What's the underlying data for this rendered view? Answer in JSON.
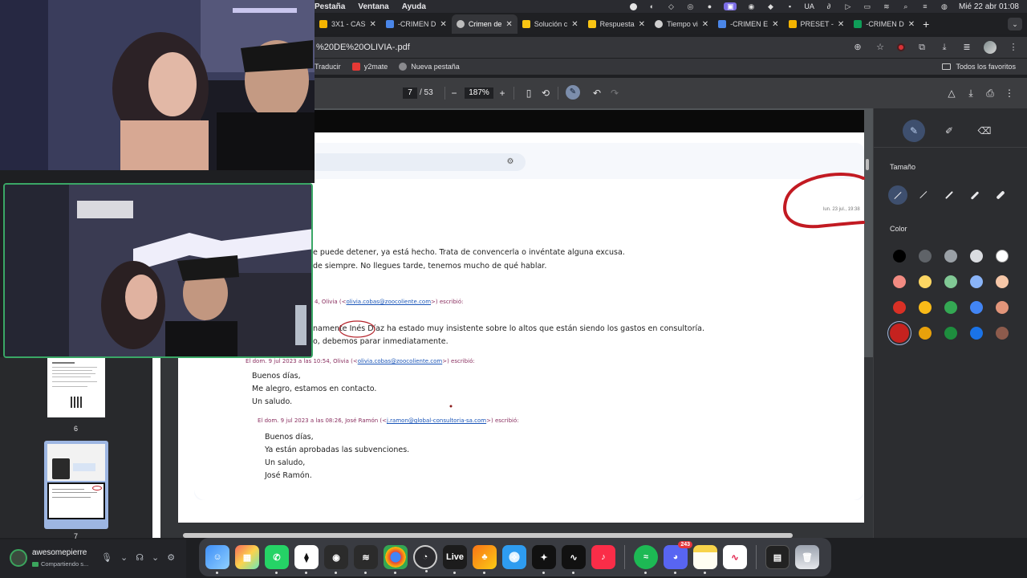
{
  "menubar": {
    "menus": [
      "Pestaña",
      "Ventana",
      "Ayuda"
    ],
    "keyboard": "UA",
    "clock": "Mié 22 abr  01:08"
  },
  "tabs": [
    {
      "title": "3X1 - CAS",
      "color": "#f4b400",
      "active": false
    },
    {
      "title": "-CRIMEN D",
      "color": "#4a86e8",
      "active": false
    },
    {
      "title": "Crimen de",
      "color": "#bdbdbd",
      "active": true
    },
    {
      "title": "Solución c",
      "color": "#f9c513",
      "active": false
    },
    {
      "title": "Respuesta",
      "color": "#f9c513",
      "active": false
    },
    {
      "title": "Tiempo vi",
      "color": "#cfcfcf",
      "active": false
    },
    {
      "title": "-CRIMEN E",
      "color": "#4a86e8",
      "active": false
    },
    {
      "title": "PRESET -",
      "color": "#f4b400",
      "active": false
    },
    {
      "title": "-CRIMEN D",
      "color": "#0f9d58",
      "active": false
    }
  ],
  "address": {
    "url": "%20DE%20OLIVIA-.pdf"
  },
  "bookmarks": {
    "items": [
      "Traducir",
      "y2mate",
      "Nueva pestaña"
    ],
    "all": "Todos los favoritos"
  },
  "pdf_toolbar": {
    "page": "7",
    "total": "/ 53",
    "zoom": "187%"
  },
  "email": {
    "date_small": "lun. 23 jul., 19:38",
    "line1": "e puede detener, ya está hecho. Trata de convencerla o invéntate alguna excusa.",
    "line2": "de siempre. No llegues tarde, tenemos mucho de qué hablar.",
    "meta1_prefix": "4, Olivia (<",
    "meta1_link": "olivia.cobas@zoocoliente.com",
    "meta1_suffix": ">) escribió:",
    "line3_pre": "namente ",
    "line3_name": "Inés Díaz",
    "line3_post": " ha estado muy insistente sobre lo altos que están siendo los gastos en consultoría.",
    "line4": "o, debemos parar inmediatamente.",
    "meta2_prefix": "El dom. 9 jul 2023 a las 10:54, Olivia (<",
    "meta2_link": "olivia.cobas@zoocoliente.com",
    "meta2_suffix": ">) escribió:",
    "reply1": [
      "Buenos días,",
      "Me alegro, estamos en contacto.",
      "Un saludo."
    ],
    "meta3_prefix": "El dom. 9 jul 2023 a las 08:26, José Ramón (<",
    "meta3_link": "j.ramon@global-consultoria-sa.com",
    "meta3_suffix": ">) escribió:",
    "reply2": [
      "Buenos días,",
      "Ya están aprobadas las subvenciones.",
      "Un saludo,",
      "José Ramón."
    ]
  },
  "thumbnails": {
    "labels": [
      "6",
      "7"
    ]
  },
  "annotation_panel": {
    "size_label": "Tamaño",
    "color_label": "Color",
    "colors": [
      [
        "#000000",
        "#5f6368",
        "#9aa0a6",
        "#dadce0",
        "#ffffff"
      ],
      [
        "#f28b82",
        "#fdd663",
        "#81c995",
        "#8ab4f8",
        "#f6c7a8"
      ],
      [
        "#d93025",
        "#f9ba18",
        "#34a853",
        "#4285f4",
        "#e2957a"
      ],
      [
        "#c5221f",
        "#e8a10b",
        "#1e8e3e",
        "#1a73e8",
        "#8d5b4c"
      ]
    ]
  },
  "user": {
    "name": "awesomepierre",
    "status": "Compartiendo s..."
  },
  "dock": {
    "live_label": "Live",
    "discord_badge": "243"
  }
}
